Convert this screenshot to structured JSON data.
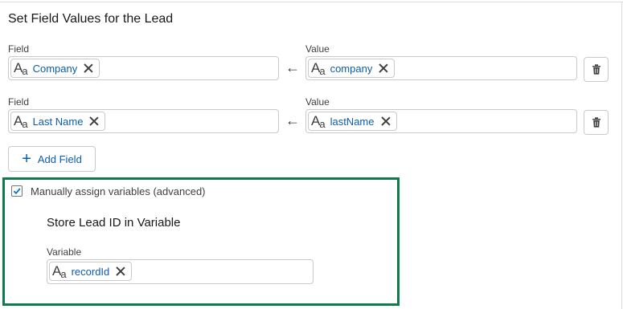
{
  "section": {
    "title": "Set Field Values for the Lead"
  },
  "rows": [
    {
      "field_label": "Field",
      "field_value": "Company",
      "value_label": "Value",
      "value_value": "company"
    },
    {
      "field_label": "Field",
      "field_value": "Last Name",
      "value_label": "Value",
      "value_value": "lastName"
    }
  ],
  "add_field": {
    "label": "Add Field"
  },
  "manual_assign": {
    "checkbox_label": "Manually assign variables (advanced)",
    "checked": true,
    "store_title": "Store Lead ID in Variable",
    "variable_label": "Variable",
    "variable_value": "recordId"
  },
  "icons": {
    "text_type": "text-type-icon",
    "remove": "close-icon",
    "arrow": "arrow-left-icon",
    "delete": "trash-icon",
    "add": "plus-icon",
    "check": "check-icon"
  },
  "colors": {
    "accent": "#0b5cab",
    "highlight_border": "#0f7a4b"
  }
}
